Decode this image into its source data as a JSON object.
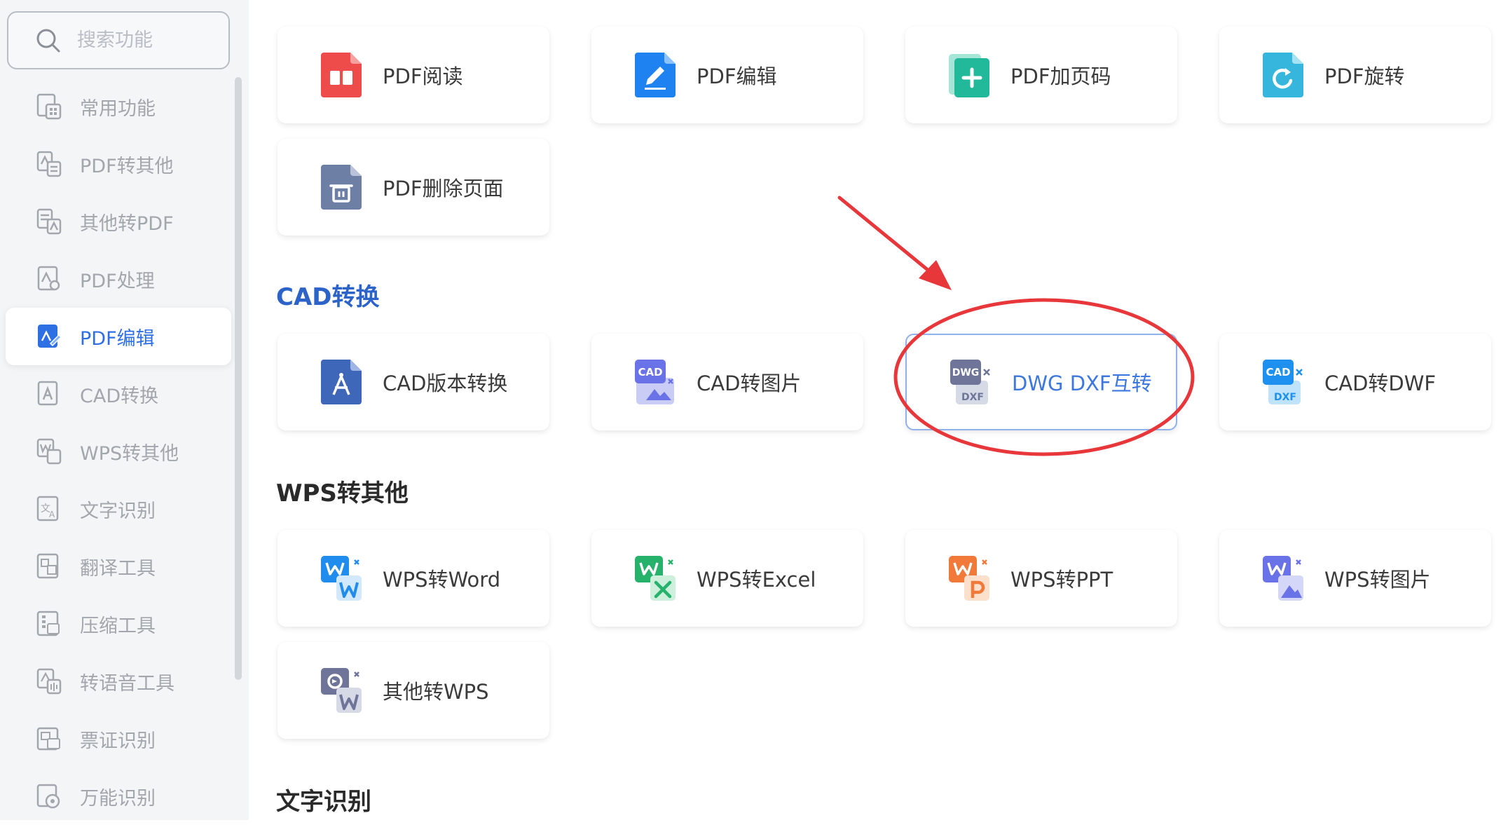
{
  "search": {
    "placeholder": "搜索功能"
  },
  "sidebar": {
    "items": [
      {
        "label": "常用功能"
      },
      {
        "label": "PDF转其他"
      },
      {
        "label": "其他转PDF"
      },
      {
        "label": "PDF处理"
      },
      {
        "label": "PDF编辑"
      },
      {
        "label": "CAD转换"
      },
      {
        "label": "WPS转其他"
      },
      {
        "label": "文字识别"
      },
      {
        "label": "翻译工具"
      },
      {
        "label": "压缩工具"
      },
      {
        "label": "转语音工具"
      },
      {
        "label": "票证识别"
      },
      {
        "label": "万能识别"
      }
    ]
  },
  "pdf_edit": {
    "cards": [
      {
        "label": "PDF阅读"
      },
      {
        "label": "PDF编辑"
      },
      {
        "label": "PDF加页码"
      },
      {
        "label": "PDF旋转"
      },
      {
        "label": "PDF删除页面"
      }
    ]
  },
  "cad": {
    "title": "CAD转换",
    "cards": [
      {
        "label": "CAD版本转换"
      },
      {
        "label": "CAD转图片",
        "badge": "CAD"
      },
      {
        "label": "DWG DXF互转",
        "badge_top": "DWG",
        "badge_bottom": "DXF"
      },
      {
        "label": "CAD转DWF",
        "badge_top": "CAD",
        "badge_bottom": "DXF"
      }
    ]
  },
  "wps": {
    "title": "WPS转其他",
    "cards": [
      {
        "label": "WPS转Word"
      },
      {
        "label": "WPS转Excel"
      },
      {
        "label": "WPS转PPT"
      },
      {
        "label": "WPS转图片"
      },
      {
        "label": "其他转WPS"
      }
    ]
  },
  "ocr": {
    "title": "文字识别"
  },
  "colors": {
    "accent": "#2f6fe4",
    "annotation": "#e8373a",
    "sidebar_bg": "#f4f5f7",
    "pdf_read_icon": "#ee4b4b",
    "pdf_edit_icon": "#1e82f0",
    "pdf_page_icon": "#22b89a",
    "pdf_rotate_icon": "#36b6dc",
    "pdf_delete_icon": "#6e7fa6",
    "cad_version_icon": "#3f67b9",
    "word_icon": "#1f8cee",
    "excel_icon": "#27b26c",
    "ppt_icon": "#f1793a",
    "image_icon": "#6a72e8"
  }
}
